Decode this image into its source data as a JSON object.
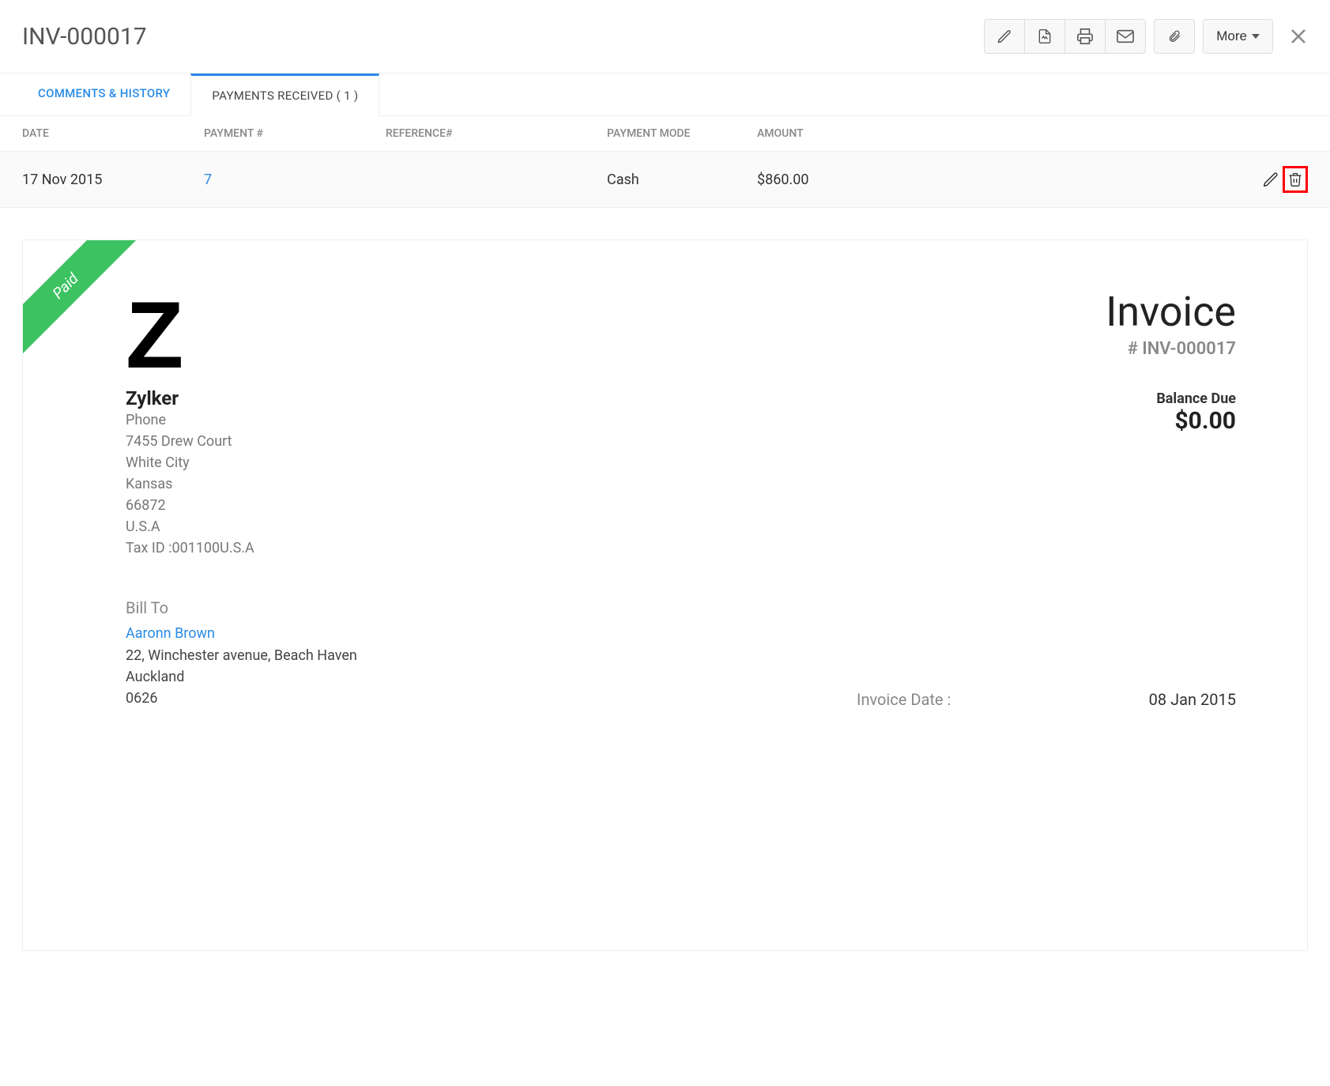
{
  "header": {
    "title": "INV-000017",
    "more_label": "More"
  },
  "tabs": {
    "comments": "COMMENTS & HISTORY",
    "payments": "PAYMENTS RECEIVED ( 1 )"
  },
  "table": {
    "headers": {
      "date": "DATE",
      "payment_no": "PAYMENT #",
      "reference": "REFERENCE#",
      "mode": "PAYMENT MODE",
      "amount": "AMOUNT"
    },
    "rows": [
      {
        "date": "17 Nov 2015",
        "payment_no": "7",
        "reference": "",
        "mode": "Cash",
        "amount": "$860.00"
      }
    ]
  },
  "invoice": {
    "ribbon": "Paid",
    "logo_letter": "Z",
    "company": {
      "name": "Zylker",
      "phone": "Phone",
      "addr1": "7455 Drew Court",
      "city": "White City",
      "state": "Kansas",
      "zip": "66872",
      "country": "U.S.A",
      "tax": "Tax ID :001100U.S.A"
    },
    "heading": "Invoice",
    "number": "# INV-000017",
    "balance_label": "Balance Due",
    "balance_value": "$0.00",
    "bill_to_label": "Bill To",
    "bill_to": {
      "name": "Aaronn Brown",
      "addr1": "22, Winchester avenue, Beach Haven",
      "city": "Auckland",
      "zip": "0626"
    },
    "dates": {
      "invoice_date_label": "Invoice Date :",
      "invoice_date_value": "08 Jan 2015"
    }
  }
}
